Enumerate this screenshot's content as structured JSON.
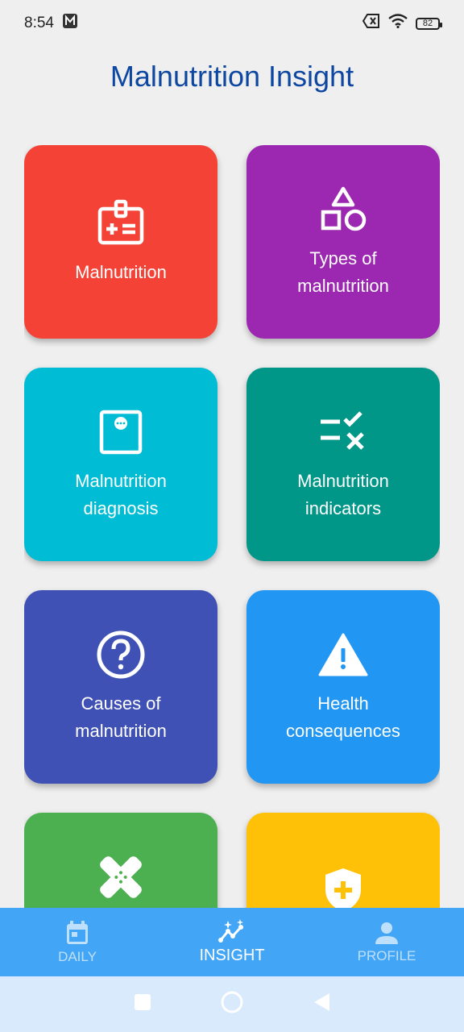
{
  "status": {
    "time": "8:54",
    "battery": "82"
  },
  "app": {
    "title": "Malnutrition Insight"
  },
  "cards": [
    {
      "label": "Malnutrition",
      "color": "#f44336",
      "icon": "badge-icon"
    },
    {
      "label": "Types of malnutrition",
      "color": "#9c27b0",
      "icon": "shapes-icon"
    },
    {
      "label": "Malnutrition diagnosis",
      "color": "#00bcd4",
      "icon": "scale-icon"
    },
    {
      "label": "Malnutrition indicators",
      "color": "#009688",
      "icon": "rule-icon"
    },
    {
      "label": "Causes of malnutrition",
      "color": "#3f51b5",
      "icon": "help-icon"
    },
    {
      "label": "Health consequences",
      "color": "#2196f3",
      "icon": "warning-icon"
    },
    {
      "label": "",
      "color": "#4caf50",
      "icon": "healing-icon"
    },
    {
      "label": "",
      "color": "#ffc107",
      "icon": "health-shield-icon"
    }
  ],
  "nav": {
    "daily": "DAILY",
    "insight": "INSIGHT",
    "profile": "PROFILE"
  }
}
